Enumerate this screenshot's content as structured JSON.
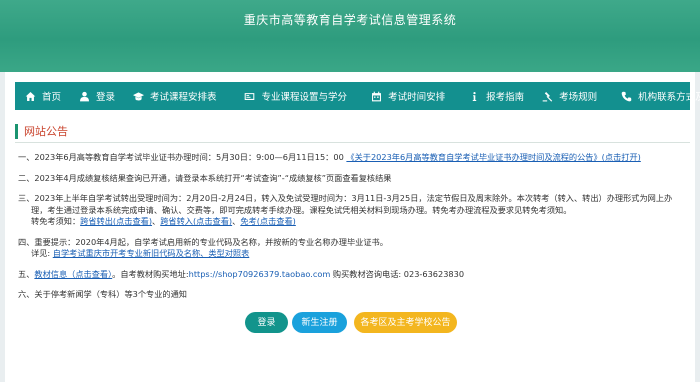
{
  "header": {
    "title": "重庆市高等教育自学考试信息管理系统"
  },
  "nav": [
    {
      "label": "首页",
      "icon": "home-icon"
    },
    {
      "label": "登录",
      "icon": "user-icon"
    },
    {
      "label": "考试课程安排表",
      "icon": "graduation-cap-icon"
    },
    {
      "label": "专业课程设置与学分",
      "icon": "id-card-icon"
    },
    {
      "label": "考试时间安排",
      "icon": "calendar-icon"
    },
    {
      "label": "报考指南",
      "icon": "info-icon"
    },
    {
      "label": "考场规则",
      "icon": "gavel-icon"
    },
    {
      "label": "机构联系方式及公告",
      "icon": "phone-icon"
    }
  ],
  "notices_title": "网站公告",
  "notices": {
    "n1": {
      "text": "一、2023年6月高等教育自学考试毕业证书办理时间：5月30日：9:00—6月11日15：00 ",
      "link": "《关于2023年6月高等教育自学考试毕业证书办理时间及流程的公告》(点击打开)"
    },
    "n2": {
      "text": "二、2023年4月成绩复核结果查询已开通，请登录本系统打开“考试查询”-“成绩复核”页面查看复核结果"
    },
    "n3": {
      "line1": "三、2023年上半年自学考试转出受理时间为：2月20日-2月24日，转入及免试受理时间为：3月11日-3月25日，法定节假日及周末除外。本次转考（转入、转出）办理形式为网上办",
      "line2": "理，考生通过登录本系统完成申请、确认、交费等，即可完成转考手续办理。课程免试凭相关材料到现场办理。转免考办理流程及要求见转免考须知。",
      "prefix": "转免考须知：",
      "link1": "跨省转出(点击查看)",
      "link2": "跨省转入(点击查看)",
      "link3": "免考(点击查看)"
    },
    "n4": {
      "line1": "四、重要提示：2020年4月起，自学考试启用新的专业代码及名称，并按新的专业名称办理毕业证书。",
      "prefix": "详见:",
      "link": "自学考试重庆市开考专业新旧代码及名称、类型对照表"
    },
    "n5": {
      "link": "教材信息（点击查看）",
      "text1": "。自考教材购买地址:",
      "url": "https://shop70926379.taobao.com",
      "text2": " 购买教材咨询电话:  023-63623830"
    },
    "n6": {
      "text": "六、关于停考新闻学（专科）等3个专业的通知"
    }
  },
  "buttons": {
    "login": "登录",
    "register": "新生注册",
    "exam_office": "各考区及主考学校公告"
  },
  "colors": {
    "header_green": "#2e9c7e",
    "nav_teal": "#13908f",
    "notice_title": "#c9432c",
    "link_blue": "#1a5fb4",
    "btn_login": "#12948c",
    "btn_register": "#1aa1dc",
    "btn_exam_office": "#f3b61f"
  }
}
